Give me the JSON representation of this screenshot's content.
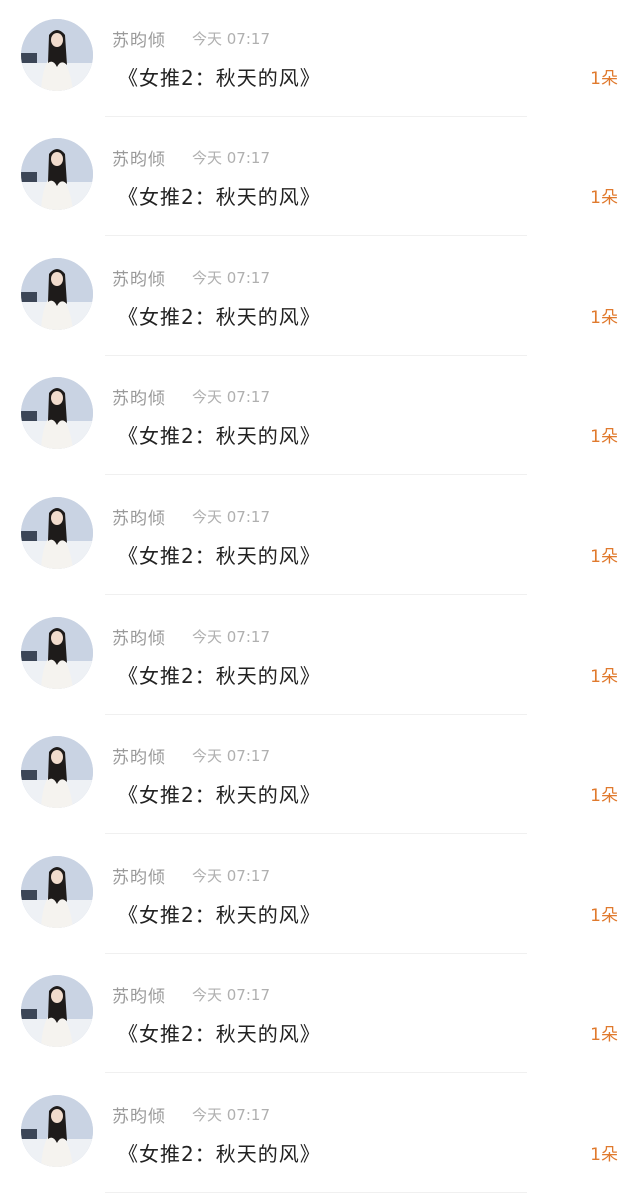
{
  "items": [
    {
      "name": "苏昀倾",
      "time": "今天 07:17",
      "title": "《女推2：秋天的风》",
      "count": "1朵"
    },
    {
      "name": "苏昀倾",
      "time": "今天 07:17",
      "title": "《女推2：秋天的风》",
      "count": "1朵"
    },
    {
      "name": "苏昀倾",
      "time": "今天 07:17",
      "title": "《女推2：秋天的风》",
      "count": "1朵"
    },
    {
      "name": "苏昀倾",
      "time": "今天 07:17",
      "title": "《女推2：秋天的风》",
      "count": "1朵"
    },
    {
      "name": "苏昀倾",
      "time": "今天 07:17",
      "title": "《女推2：秋天的风》",
      "count": "1朵"
    },
    {
      "name": "苏昀倾",
      "time": "今天 07:17",
      "title": "《女推2：秋天的风》",
      "count": "1朵"
    },
    {
      "name": "苏昀倾",
      "time": "今天 07:17",
      "title": "《女推2：秋天的风》",
      "count": "1朵"
    },
    {
      "name": "苏昀倾",
      "time": "今天 07:17",
      "title": "《女推2：秋天的风》",
      "count": "1朵"
    },
    {
      "name": "苏昀倾",
      "time": "今天 07:17",
      "title": "《女推2：秋天的风》",
      "count": "1朵"
    },
    {
      "name": "苏昀倾",
      "time": "今天 07:17",
      "title": "《女推2：秋天的风》",
      "count": "1朵"
    }
  ],
  "colors": {
    "name": "#9a9a9a",
    "time": "#b0b0b0",
    "title": "#222222",
    "count": "#e07a2e",
    "divider": "#f0f0f0"
  }
}
